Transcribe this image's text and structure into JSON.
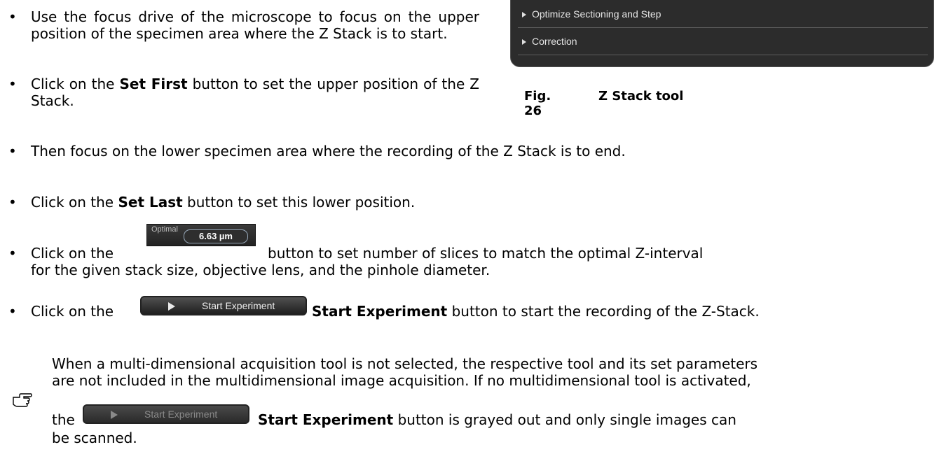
{
  "panel": {
    "rows": [
      "Optimize Sectioning and Step",
      "Correction"
    ]
  },
  "figure": {
    "number": "Fig. 26",
    "title": "Z Stack tool"
  },
  "bullets": {
    "b1": "Use the focus drive of the microscope to focus on the upper position of the specimen area where the Z Stack is to start.",
    "b2_pre": "Click on the ",
    "b2_bold": "Set First",
    "b2_post": " button to set the upper position of the Z Stack.",
    "b3": "Then focus on the lower specimen area where the recording of the Z Stack is to end.",
    "b4_pre": "Click on the ",
    "b4_bold": "Set Last",
    "b4_post": " button to set this lower position.",
    "b5_pre": "Click on the",
    "b5_post": "button to set number of slices to match the optimal Z-interval",
    "b5_line2": "for the given stack size, objective lens, and the pinhole diameter.",
    "b6_pre": "Click on the",
    "b6_bold": "Start Experiment",
    "b6_post": " button to start the recording of the Z-Stack."
  },
  "optimal": {
    "label": "Optimal",
    "value": "6.63 µm"
  },
  "start_button": {
    "label": "Start Experiment"
  },
  "note": {
    "line1": "When a multi-dimensional acquisition tool is not selected, the respective tool and its set parameters",
    "line2": "are not included in the multidimensional image acquisition. If no multidimensional tool is activated,",
    "line3_pre": "the",
    "line3_bold": "Start Experiment",
    "line3_post": " button is grayed out and only single images can",
    "line4": "be scanned."
  }
}
